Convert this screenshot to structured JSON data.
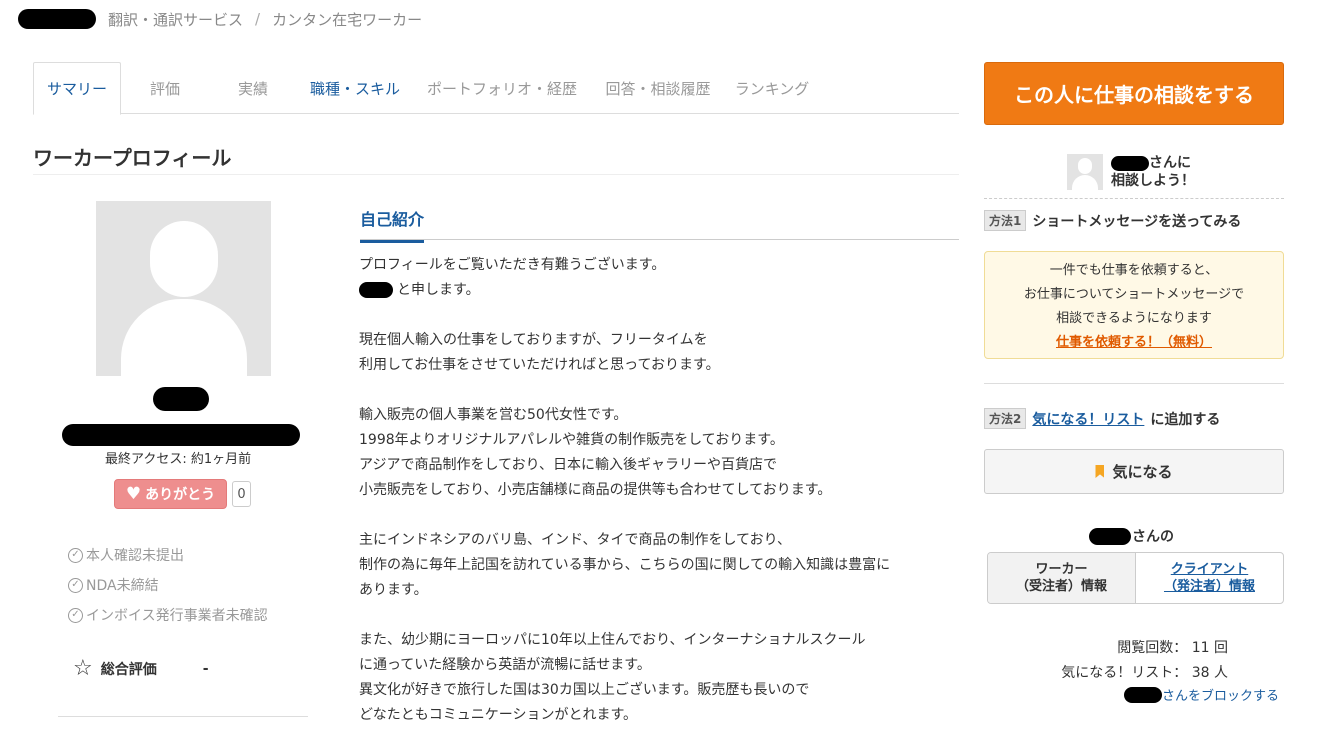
{
  "breadcrumb": {
    "items": [
      "翻訳・通訳サービス",
      "カンタン在宅ワーカー"
    ],
    "separator": "/"
  },
  "tabs": [
    {
      "label": "サマリー",
      "active": true
    },
    {
      "label": "評価"
    },
    {
      "label": "実績"
    },
    {
      "label": "職種・スキル"
    },
    {
      "label": "ポートフォリオ・経歴"
    },
    {
      "label": "回答・相談履歴"
    },
    {
      "label": "ランキング"
    }
  ],
  "profile": {
    "title": "ワーカープロフィール",
    "last_access": "最終アクセス: 約1ヶ月前",
    "thanks_label": "ありがとう",
    "thanks_count": "0",
    "status": [
      "本人確認未提出",
      "NDA未締結",
      "インボイス発行事業者未確認"
    ],
    "rating_label": "総合評価",
    "rating_value": "-"
  },
  "intro": {
    "heading": "自己紹介",
    "lines": [
      "プロフィールをご覧いただき有難うございます。",
      "と申します。",
      "",
      "現在個人輸入の仕事をしておりますが、フリータイムを",
      "利用してお仕事をさせていただければと思っております。",
      "",
      "輸入販売の個人事業を営む50代女性です。",
      "1998年よりオリジナルアパレルや雑貨の制作販売をしております。",
      "アジアで商品制作をしており、日本に輸入後ギャラリーや百貨店で",
      "小売販売をしており、小売店舗様に商品の提供等も合わせてしております。",
      "",
      "主にインドネシアのバリ島、インド、タイで商品の制作をしており、",
      "制作の為に毎年上記国を訪れている事から、こちらの国に関しての輸入知識は豊富に",
      "あります。",
      "",
      "また、幼少期にヨーロッパに10年以上住んでおり、インターナショナルスクール",
      "に通っていた経験から英語が流暢に話せます。",
      "異文化が好きで旅行した国は30カ国以上ございます。販売歴も長いので",
      "どなたともコミュニケーションがとれます。"
    ]
  },
  "sidebar": {
    "cta_label": "この人に仕事の相談をする",
    "consult_line1": "さんに",
    "consult_line2": "相談しよう！",
    "method1_tag": "方法1",
    "method1_text": "ショートメッセージを送ってみる",
    "notice_lines": [
      "一件でも仕事を依頼すると、",
      "お仕事についてショートメッセージで",
      "相談できるようになります"
    ],
    "notice_link": "仕事を依頼する！（無料）",
    "method2_tag": "方法2",
    "method2_link": "気になる！リスト",
    "method2_text": "に追加する",
    "fav_label": "気になる",
    "san_no": "さんの",
    "info_tab_worker_1": "ワーカー",
    "info_tab_worker_2": "（受注者）情報",
    "info_tab_client_1": "クライアント",
    "info_tab_client_2": "（発注者）情報",
    "views": "閲覧回数：  11 回",
    "fav_count": "気になる！リスト：  38 人",
    "block_label": "さんをブロックする"
  },
  "colors": {
    "accent_orange": "#f07a14",
    "link_blue": "#1a5c9e",
    "thanks_pink": "#ee8e8e"
  }
}
